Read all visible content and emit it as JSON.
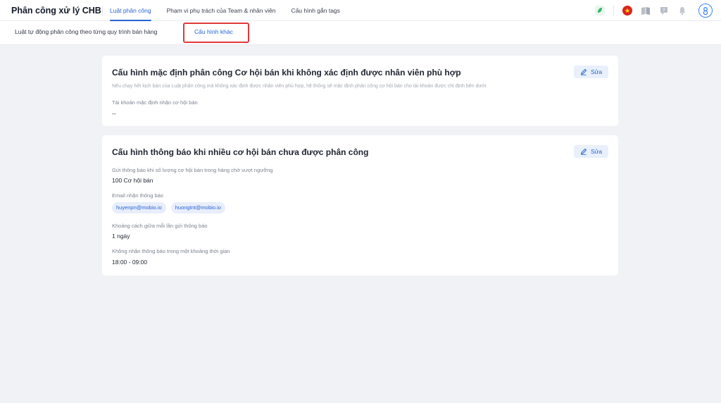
{
  "header": {
    "title": "Phân công xử lý CHB",
    "tabs": [
      {
        "label": "Luật phân công",
        "active": true
      },
      {
        "label": "Phạm vi phụ trách của Team & nhân viên",
        "active": false
      },
      {
        "label": "Cấu hình gắn tags",
        "active": false
      }
    ],
    "icons": [
      "leaf-icon",
      "vietnam-flag-icon",
      "book-icon",
      "help-icon",
      "bell-icon",
      "avatar-icon"
    ]
  },
  "subnav": {
    "tabs": [
      {
        "label": "Luật tự động phân công theo từng quy trình bán hàng",
        "active": false
      },
      {
        "label": "Cấu hình khác",
        "active": true
      }
    ]
  },
  "cards": {
    "default_assign": {
      "title": "Cấu hình mặc định phân công Cơ hội bán khi không xác định được nhân viên phù hợp",
      "edit_label": "Sửa",
      "description": "Nếu chạy hết kịch bản của Luật phân công mà không xác định được nhân viên phù hợp, hệ thống sẽ mặc định phân công cơ hội bán cho tài khoản được chỉ định bên dưới.",
      "account_label": "Tài khoản mặc định nhận cơ hội bán",
      "account_value": "--"
    },
    "notify": {
      "title": "Cấu hình thông báo khi nhiều cơ hội bán chưa được phân công",
      "edit_label": "Sửa",
      "threshold_label": "Gửi thông báo khi số lượng cơ hội bán trong hàng chờ vượt ngưỡng",
      "threshold_value": "100 Cơ hội bán",
      "email_label": "Email nhận thông báo",
      "emails": [
        "huyenpn@mobio.io",
        "huongtnt@mobio.io"
      ],
      "interval_label": "Khoảng cách giữa mỗi lần gửi thông báo",
      "interval_value": "1 ngày",
      "quiet_label": "Không nhận thông báo trong một khoảng thời gian",
      "quiet_value": "18:00 - 09:00"
    }
  },
  "colors": {
    "accent": "#2563d6",
    "highlight": "#e0393a",
    "background": "#f1f2f5"
  }
}
